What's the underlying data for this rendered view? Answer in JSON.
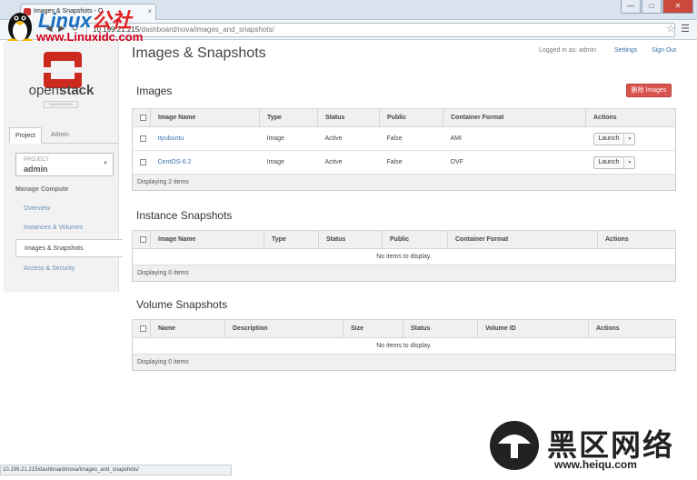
{
  "browser": {
    "tab_title": "Images & Snapshots - O",
    "tab_close": "×",
    "nav_back": "◀",
    "nav_forward": "▶",
    "nav_reload": "↻",
    "url_host": "10.199.21.215",
    "url_path": "/dashboard/nova/images_and_snapshots/",
    "window_controls": [
      "—",
      "□",
      "✕"
    ],
    "status_url": "10.199.21.215/dashboard/nova/images_and_snapshots/"
  },
  "watermark": {
    "title_main": "Linux",
    "title_cn": "公社",
    "url": "www.Linuxidc.com",
    "bottom_cn": "黑区网络",
    "bottom_url": "www.heiqu.com"
  },
  "brand": {
    "logo_open": "open",
    "logo_stack": "stack",
    "logo_sub": "DASHBOARD",
    "logo_color": "#cc2a1f"
  },
  "sidebar": {
    "tabs": [
      "Project",
      "Admin"
    ],
    "project_label": "PROJECT",
    "project_value": "admin",
    "section": "Manage Compute",
    "items": [
      "Overview",
      "Instances & Volumes",
      "Images & Snapshots",
      "Access & Security"
    ],
    "selected_index": 2
  },
  "header": {
    "title": "Images & Snapshots",
    "logged_in": "Logged in as: admin",
    "settings": "Settings",
    "sign_out": "Sign Out"
  },
  "images": {
    "title": "Images",
    "delete_button": "删除 Images",
    "columns": [
      "Image Name",
      "Type",
      "Status",
      "Public",
      "Container Format",
      "Actions"
    ],
    "rows": [
      {
        "name": "ttyubuntu",
        "type": "Image",
        "status": "Active",
        "public": "False",
        "format": "AMI",
        "action": "Launch"
      },
      {
        "name": "CentOS-6.2",
        "type": "Image",
        "status": "Active",
        "public": "False",
        "format": "OVF",
        "action": "Launch"
      }
    ],
    "footer": "Displaying 2 items"
  },
  "instance_snapshots": {
    "title": "Instance Snapshots",
    "columns": [
      "Image Name",
      "Type",
      "Status",
      "Public",
      "Container Format",
      "Actions"
    ],
    "empty": "No items to display.",
    "footer": "Displaying 0 items"
  },
  "volume_snapshots": {
    "title": "Volume Snapshots",
    "columns": [
      "Name",
      "Description",
      "Size",
      "Status",
      "Volume ID",
      "Actions"
    ],
    "empty": "No items to display.",
    "footer": "Displaying 0 items"
  }
}
